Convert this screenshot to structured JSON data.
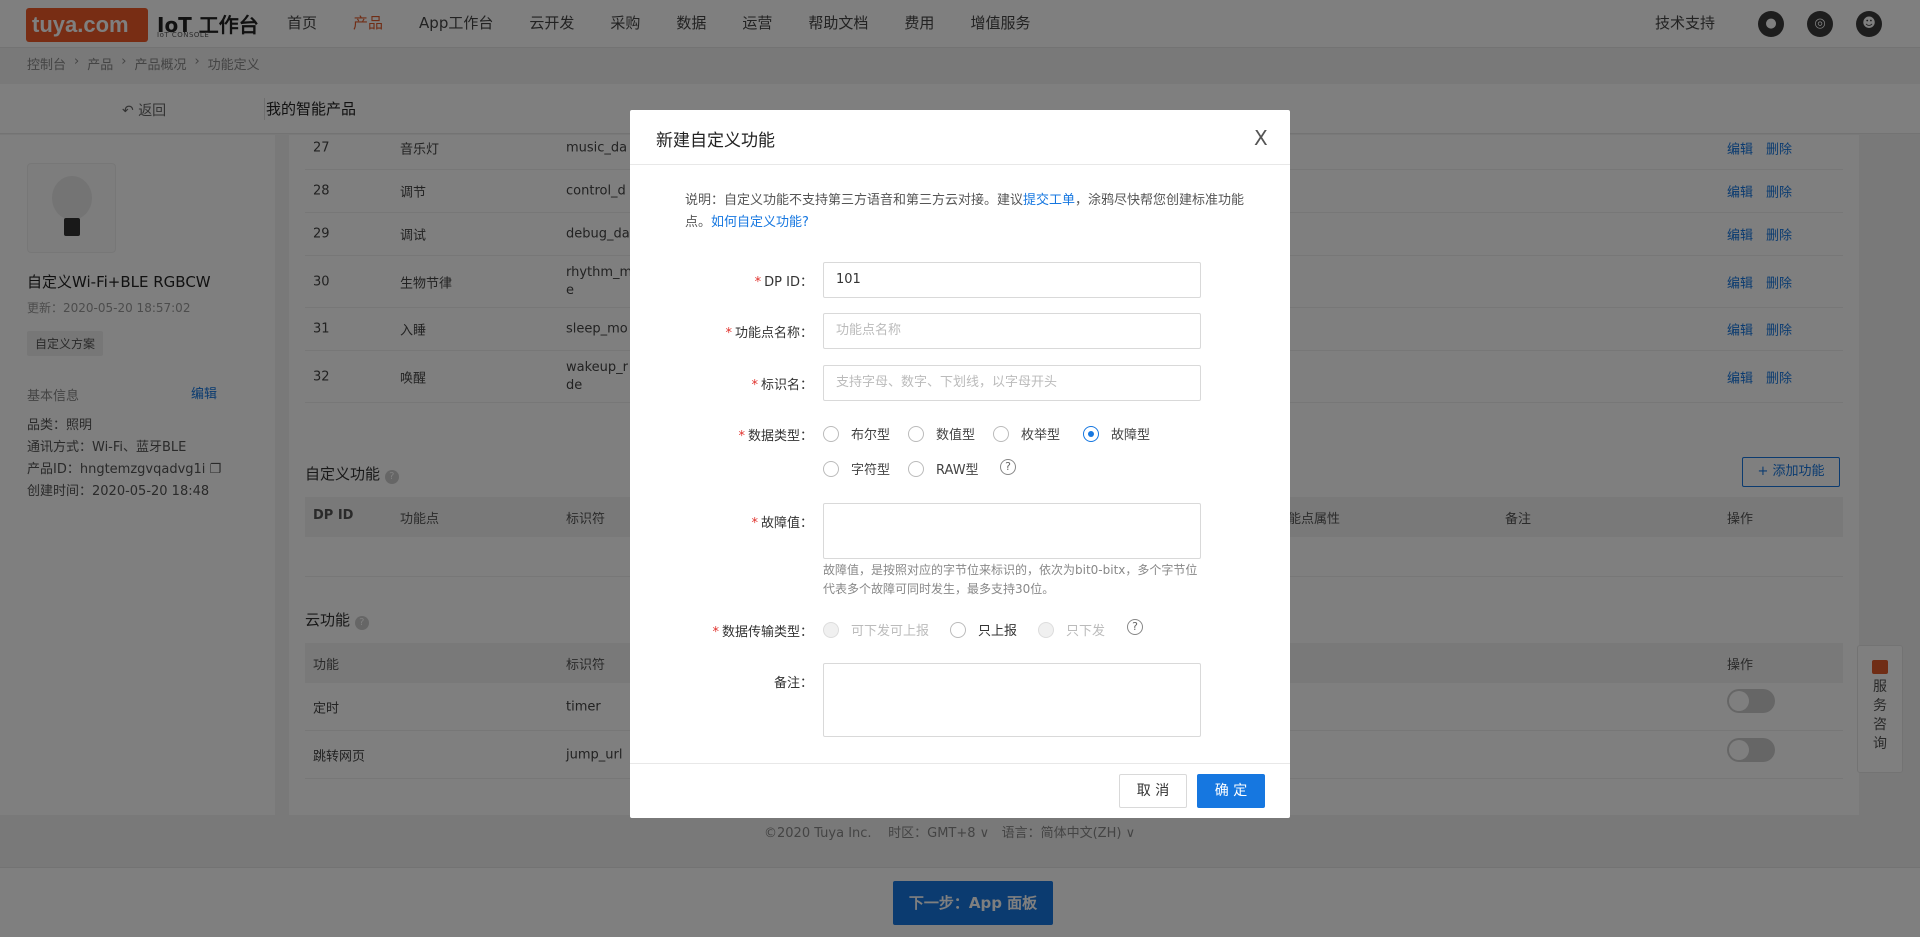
{
  "topbar": {
    "logo": "tuya.com",
    "console_title": "IoT 工作台",
    "console_sub": "IoT CONSOLE",
    "nav": [
      "首页",
      "产品",
      "App工作台",
      "云开发",
      "采购",
      "数据",
      "运营",
      "帮助文档",
      "费用",
      "增值服务"
    ],
    "tech_support": "技术支持"
  },
  "breadcrumb": [
    "控制台",
    "产品",
    "产品概况",
    "功能定义"
  ],
  "subbar": {
    "back": "返回",
    "product_title": "我的智能产品"
  },
  "left": {
    "name": "自定义Wi-Fi+BLE RGBCW",
    "updated": "更新：2020-05-20 18:57:02",
    "tag": "自定义方案",
    "basic_info": "基本信息",
    "edit": "编辑",
    "category": "品类：照明",
    "comm": "通讯方式：Wi-Fi、蓝牙BLE",
    "pid": "产品ID：hngtemzgvqadvg1i",
    "created": "创建时间：2020-05-20 18:48"
  },
  "main": {
    "rows": [
      {
        "id": "27",
        "name": "音乐灯",
        "code": "music_da"
      },
      {
        "id": "28",
        "name": "调节",
        "code": "control_d"
      },
      {
        "id": "29",
        "name": "调试",
        "code": "debug_da"
      },
      {
        "id": "30",
        "name": "生物节律",
        "code": "rhythm_m",
        "code2": "e"
      },
      {
        "id": "31",
        "name": "入睡",
        "code": "sleep_mo"
      },
      {
        "id": "32",
        "name": "唤醒",
        "code": "wakeup_r",
        "code2": "de"
      }
    ],
    "edit": "编辑",
    "delete": "删除",
    "custom_title": "自定义功能",
    "add_btn": "+ 添加功能",
    "custom_headers": {
      "id": "DP ID",
      "name": "功能点",
      "code": "标识符",
      "attr": "功能点属性",
      "note": "备注",
      "op": "操作"
    },
    "cloud_title": "云功能",
    "cloud_headers": {
      "fn": "功能",
      "code": "标识符",
      "op": "操作"
    },
    "cloud_rows": [
      {
        "name": "定时",
        "code": "timer"
      },
      {
        "name": "跳转网页",
        "code": "jump_url"
      }
    ]
  },
  "footer": {
    "copy": "©2020 Tuya Inc.",
    "tz_label": "时区：",
    "tz": "GMT+8",
    "lang_label": "语言：",
    "lang": "简体中文(ZH)"
  },
  "next_btn": "下一步：App 面板",
  "service": [
    "服",
    "务",
    "咨",
    "询"
  ],
  "modal": {
    "title": "新建自定义功能",
    "close": "X",
    "note_pre": "说明：自定义功能不支持第三方语音和第三方云对接。建议",
    "note_link1": "提交工单",
    "note_mid": "，涂鸦尽快帮您创建标准功能点。",
    "note_link2": "如何自定义功能?",
    "dp_label": "DP ID：",
    "dp_value": "101",
    "name_label": "功能点名称：",
    "name_ph": "功能点名称",
    "code_label": "标识名：",
    "code_ph": "支持字母、数字、下划线，以字母开头",
    "type_label": "数据类型：",
    "types": [
      "布尔型",
      "数值型",
      "枚举型",
      "故障型",
      "字符型",
      "RAW型"
    ],
    "fault_label": "故障值：",
    "fault_hint": "故障值，是按照对应的字节位来标识的，依次为bit0-bitx，多个字节位代表多个故障可同时发生，最多支持30位。",
    "trans_label": "数据传输类型：",
    "trans": [
      "可下发可上报",
      "只上报",
      "只下发"
    ],
    "remark_label": "备注：",
    "cancel": "取 消",
    "ok": "确 定"
  }
}
